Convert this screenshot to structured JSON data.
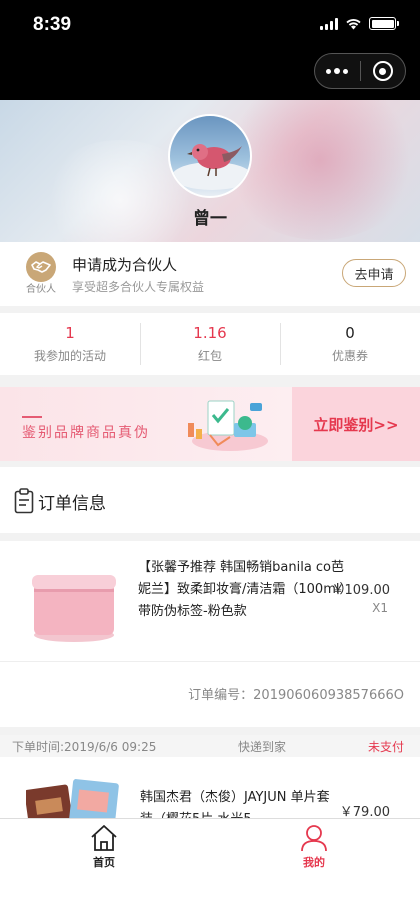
{
  "status_bar": {
    "time": "8:39"
  },
  "profile": {
    "username": "曾一"
  },
  "partner": {
    "icon_label": "合伙人",
    "title": "申请成为合伙人",
    "subtitle": "享受超多合伙人专属权益",
    "apply_label": "去申请"
  },
  "stats": [
    {
      "value": "1",
      "label": "我参加的活动"
    },
    {
      "value": "1.16",
      "label": "红包"
    },
    {
      "value": "0",
      "label": "优惠券"
    }
  ],
  "banner": {
    "text": "鉴别品牌商品真伪",
    "cta": "立即鉴别>>"
  },
  "orders": {
    "title": "订单信息",
    "order1": {
      "product_name": "【张馨予推荐 韩国畅销banila co芭妮兰】致柔卸妆膏/清洁霜（100ml）带防伪标签-粉色款",
      "price": "￥109.00",
      "quantity": "X1",
      "order_no": "订单编号：20190606093857666O"
    },
    "order2": {
      "time": "下单时间:2019/6/6 09:25",
      "delivery": "快递到家",
      "status": "未支付",
      "product_name": "韩国杰君（杰俊）JAYJUN 单片套装（樱花5片 水光5",
      "price": "￥79.00"
    }
  },
  "tabbar": {
    "home": "首页",
    "mine": "我的"
  },
  "colors": {
    "accent": "#e5384e",
    "gold": "#c9a777"
  }
}
